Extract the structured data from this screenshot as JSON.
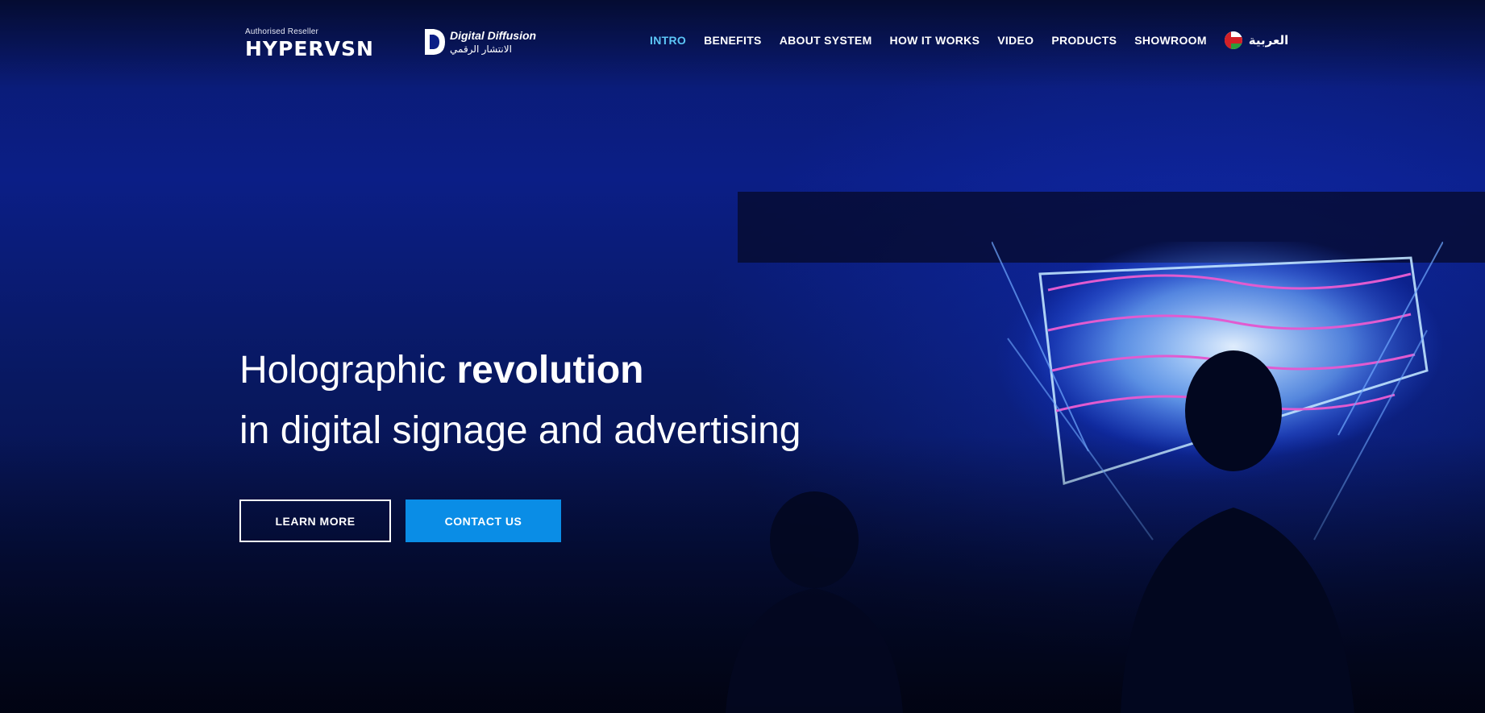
{
  "header": {
    "reseller_label": "Authorised Reseller",
    "brand_name": "HYPERVSN",
    "partner_name_en": "Digital Diffusion",
    "partner_name_ar": "الانتشار الرقمي",
    "nav": [
      {
        "label": "INTRO",
        "active": true
      },
      {
        "label": "BENEFITS",
        "active": false
      },
      {
        "label": "ABOUT SYSTEM",
        "active": false
      },
      {
        "label": "HOW IT WORKS",
        "active": false
      },
      {
        "label": "VIDEO",
        "active": false
      },
      {
        "label": "PRODUCTS",
        "active": false
      },
      {
        "label": "SHOWROOM",
        "active": false
      }
    ],
    "language_label": "العربية",
    "language_flag_icon": "oman-flag-icon"
  },
  "hero": {
    "title_regular": "Holographic ",
    "title_bold": "revolution",
    "subtitle": "in digital signage and advertising",
    "learn_more_label": "LEARN MORE",
    "contact_label": "CONTACT US"
  },
  "colors": {
    "accent": "#5cc6f7",
    "button_primary": "#0a8de6",
    "background": "#0b1e86"
  }
}
